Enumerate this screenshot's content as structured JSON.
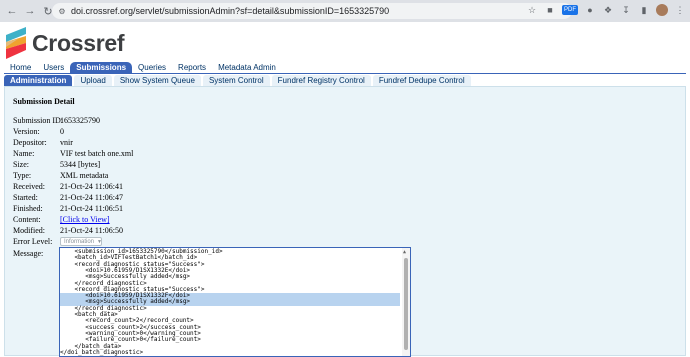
{
  "browser": {
    "url": "doi.crossref.org/servlet/submissionAdmin?sf=detail&submissionID=1653325790",
    "ext_badge": "PDF"
  },
  "logo": {
    "text": "Crossref"
  },
  "main_tabs": [
    {
      "label": "Home",
      "active": false
    },
    {
      "label": "Users",
      "active": false
    },
    {
      "label": "Submissions",
      "active": true
    },
    {
      "label": "Queries",
      "active": false
    },
    {
      "label": "Reports",
      "active": false
    },
    {
      "label": "Metadata Admin",
      "active": false
    }
  ],
  "sub_tabs": [
    {
      "label": "Administration",
      "active": true
    },
    {
      "label": "Upload",
      "active": false
    },
    {
      "label": "Show System Queue",
      "active": false
    },
    {
      "label": "System Control",
      "active": false
    },
    {
      "label": "Fundref Registry Control",
      "active": false
    },
    {
      "label": "Fundref Dedupe Control",
      "active": false
    }
  ],
  "detail": {
    "title": "Submission Detail",
    "fields": [
      {
        "label": "Submission ID:",
        "value": "1653325790"
      },
      {
        "label": "Version:",
        "value": "0"
      },
      {
        "label": "Depositor:",
        "value": "vnir"
      },
      {
        "label": "Name:",
        "value": "VIF test batch one.xml"
      },
      {
        "label": "Size:",
        "value": "5344 [bytes]"
      },
      {
        "label": "Type:",
        "value": "XML metadata"
      },
      {
        "label": "Received:",
        "value": "21-Oct-24 11:06:41"
      },
      {
        "label": "Started:",
        "value": "21-Oct-24 11:06:47"
      },
      {
        "label": "Finished:",
        "value": "21-Oct-24 11:06:51"
      },
      {
        "label": "Content:",
        "value": "[Click to View]",
        "link": true
      },
      {
        "label": "Modified:",
        "value": "21-Oct-24 11:06:50"
      }
    ],
    "error_level_label": "Error Level:",
    "error_level_value": "Information",
    "message_label": "Message:",
    "message_lines": [
      {
        "text": "    <submission_id>1653325790</submission_id>",
        "highlight": false
      },
      {
        "text": "    <batch_id>VIFTestBatch1</batch_id>",
        "highlight": false
      },
      {
        "text": "    <record_diagnostic status=\"Success\">",
        "highlight": false
      },
      {
        "text": "       <doi>10.61959/D1SX1332E</doi>",
        "highlight": false
      },
      {
        "text": "       <msg>Successfully added</msg>",
        "highlight": false
      },
      {
        "text": "    </record_diagnostic>",
        "highlight": false
      },
      {
        "text": "    <record_diagnostic status=\"Success\">",
        "highlight": false
      },
      {
        "text": "       <doi>10.61959/D1SX1332F</doi>",
        "highlight": true
      },
      {
        "text": "       <msg>Successfully added</msg>",
        "highlight": true
      },
      {
        "text": "    </record_diagnostic>",
        "highlight": false
      },
      {
        "text": "    <batch_data>",
        "highlight": false
      },
      {
        "text": "       <record_count>2</record_count>",
        "highlight": false
      },
      {
        "text": "       <success_count>2</success_count>",
        "highlight": false
      },
      {
        "text": "       <warning_count>0</warning_count>",
        "highlight": false
      },
      {
        "text": "       <failure_count>0</failure_count>",
        "highlight": false
      },
      {
        "text": "    </batch_data>",
        "highlight": false
      },
      {
        "text": "</doi_batch_diagnostic>",
        "highlight": false
      }
    ]
  },
  "colors": {
    "accent": "#3a64b8",
    "panel_bg": "#eaf4f9",
    "highlight": "#b8d3ef"
  }
}
